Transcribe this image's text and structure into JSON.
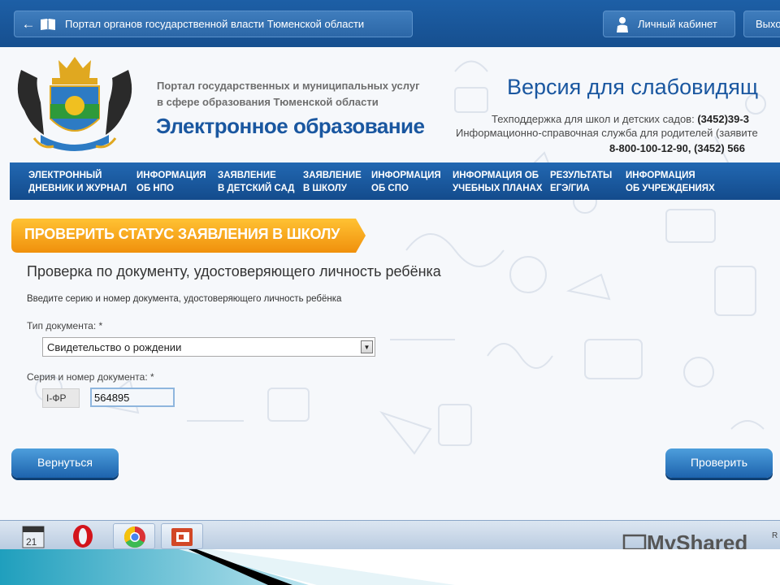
{
  "topbar": {
    "portal_title": "Портал органов государственной власти Тюменской области",
    "cabinet_label": "Личный кабинет",
    "exit_label": "Выхо"
  },
  "header": {
    "subtitle_line1": "Портал государственных и муниципальных услуг",
    "subtitle_line2": "в сфере образования Тюменской области",
    "title": "Электронное образование",
    "low_vision_link": "Версия для слабовидящ",
    "support_label": "Техподдержка для школ и детских садов:",
    "support_phone": "(3452)39-3",
    "info_service": "Информационно-справочная служба для родителей (заявите",
    "hotline": "8-800-100-12-90, (3452) 566"
  },
  "nav": [
    {
      "line1": "ЭЛЕКТРОННЫЙ",
      "line2": "ДНЕВНИК И ЖУРНАЛ"
    },
    {
      "line1": "ИНФОРМАЦИЯ",
      "line2": "ОБ НПО"
    },
    {
      "line1": "ЗАЯВЛЕНИЕ",
      "line2": "В ДЕТСКИЙ САД"
    },
    {
      "line1": "ЗАЯВЛЕНИЕ",
      "line2": "В ШКОЛУ"
    },
    {
      "line1": "ИНФОРМАЦИЯ",
      "line2": "ОБ СПО"
    },
    {
      "line1": "ИНФОРМАЦИЯ ОБ",
      "line2": "УЧЕБНЫХ ПЛАНАХ"
    },
    {
      "line1": "РЕЗУЛЬТАТЫ",
      "line2": "ЕГЭ/ГИА"
    },
    {
      "line1": "ИНФОРМАЦИЯ",
      "line2": "ОБ УЧРЕЖДЕНИЯХ"
    }
  ],
  "form": {
    "banner": "ПРОВЕРИТЬ СТАТУС ЗАЯВЛЕНИЯ В ШКОЛУ",
    "title": "Проверка по документу, удостоверяющего личность ребёнка",
    "hint": "Введите серию и номер документа, удостоверяющего личность ребёнка",
    "doc_type_label": "Тип документа: *",
    "doc_type_value": "Свидетельство о рождении",
    "series_label": "Серия и номер документа: *",
    "series_value": "I-ФР",
    "number_value": "564895",
    "back_button": "Вернуться",
    "check_button": "Проверить"
  },
  "taskbar": {
    "watermark": "MyShared",
    "tray_text": "R"
  },
  "colors": {
    "primary_blue": "#1a57a0",
    "banner_orange": "#f5a316",
    "button_blue": "#2a7bc6"
  }
}
